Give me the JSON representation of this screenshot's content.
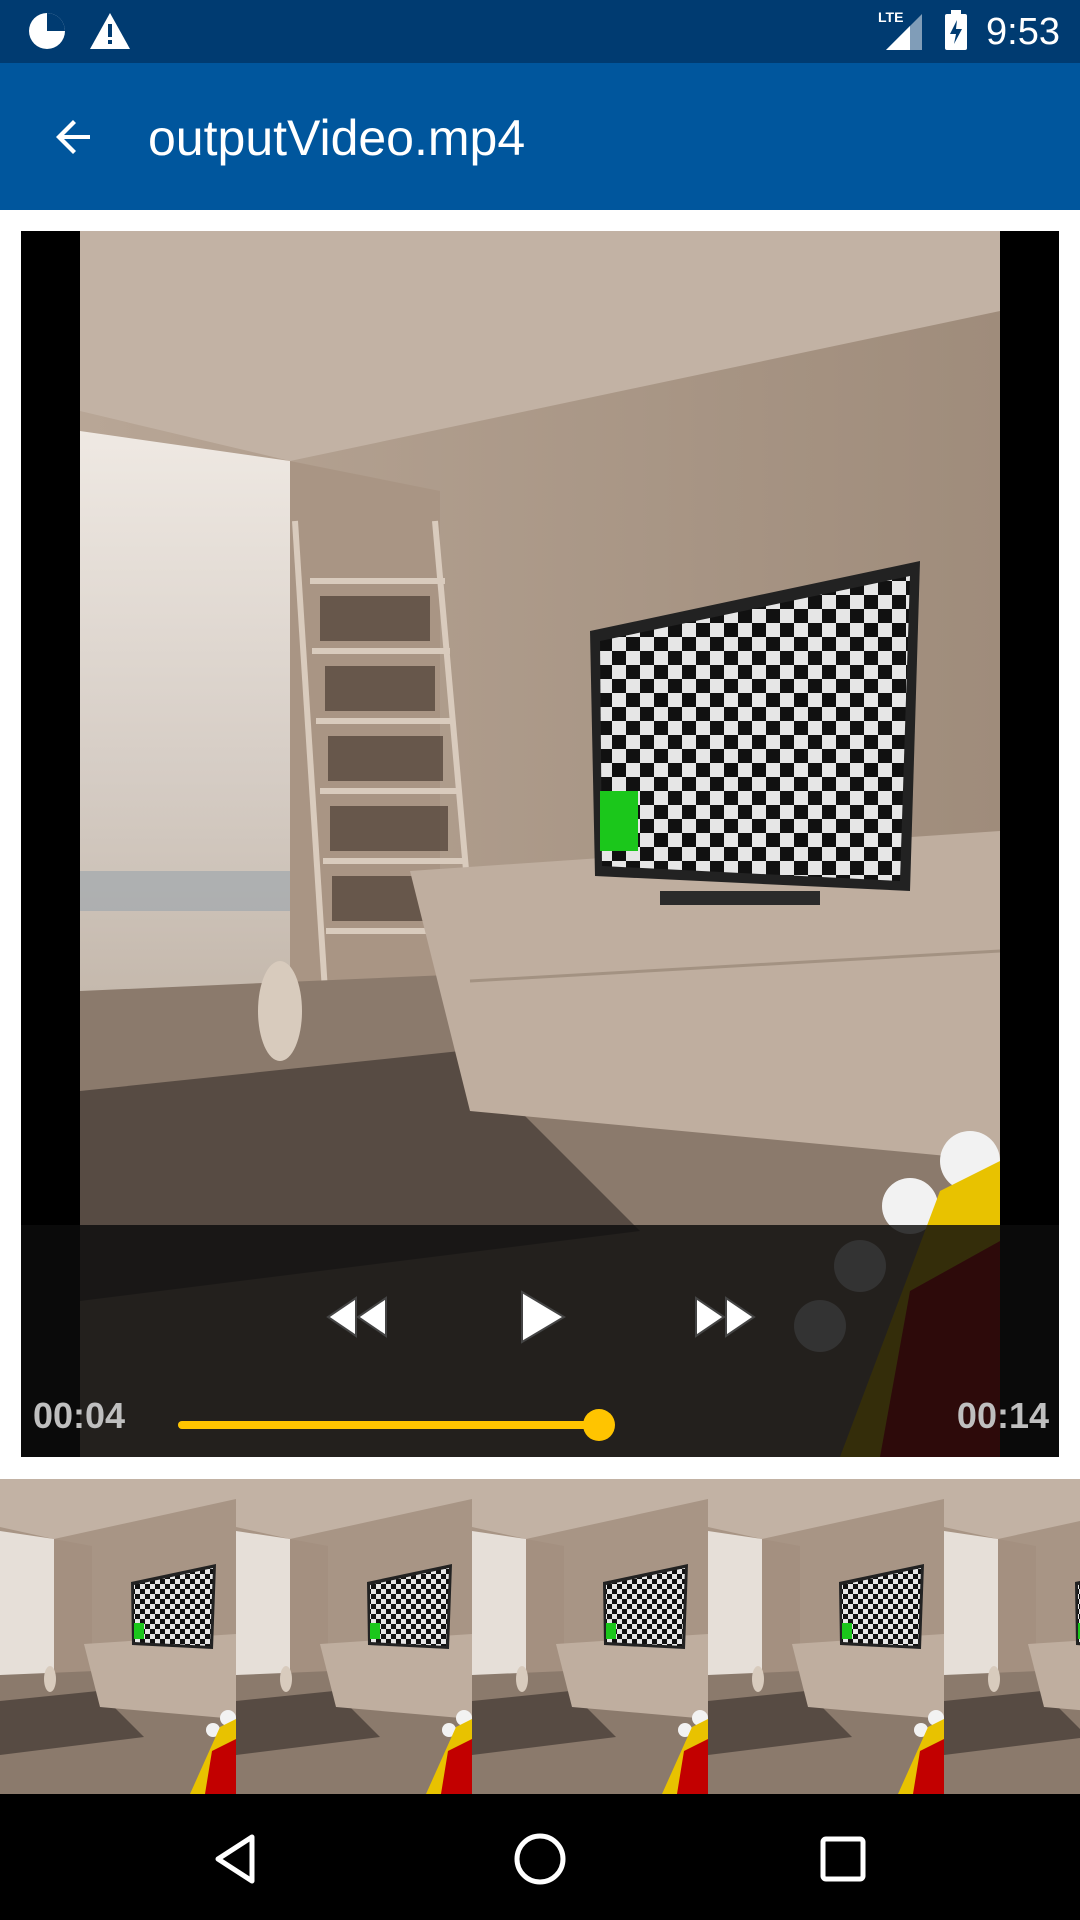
{
  "status_bar": {
    "time": "9:53",
    "network_label": "LTE",
    "icons": [
      "data-saver-icon",
      "alert-icon",
      "lte-signal-icon",
      "battery-charging-icon"
    ]
  },
  "app_bar": {
    "title": "outputVideo.mp4",
    "back_icon": "arrow-back-icon"
  },
  "player": {
    "current_time": "00:04",
    "total_time": "00:14",
    "progress": 0.98,
    "controls": [
      "rewind-icon",
      "play-icon",
      "fast-forward-icon"
    ]
  },
  "filmstrip": {
    "frame_count": 5
  },
  "nav_bar": {
    "buttons": [
      "back-nav-icon",
      "home-nav-icon",
      "recents-nav-icon"
    ]
  },
  "colors": {
    "status_bar": "#003b71",
    "app_bar": "#00569d",
    "seek_accent": "#ffc400"
  }
}
